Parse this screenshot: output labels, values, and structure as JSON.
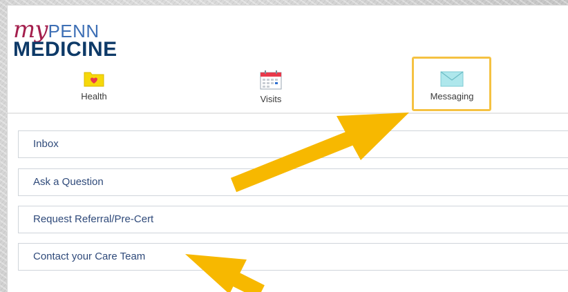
{
  "app": {
    "logo": {
      "my": "my",
      "penn": "PENN",
      "medicine": "MEDICINE"
    }
  },
  "nav": {
    "items": [
      {
        "label": "Health",
        "icon": "folder-heart-icon"
      },
      {
        "label": "Visits",
        "icon": "calendar-icon"
      },
      {
        "label": "Messaging",
        "icon": "envelope-icon",
        "highlighted": true
      }
    ]
  },
  "menu": {
    "items": [
      {
        "label": "Inbox"
      },
      {
        "label": "Ask a Question"
      },
      {
        "label": "Request Referral/Pre-Cert"
      },
      {
        "label": "Contact your Care Team"
      }
    ]
  },
  "colors": {
    "logo_my": "#a41f4d",
    "logo_penn": "#3d6fb5",
    "logo_medicine": "#0e3a68",
    "highlight_border": "#f5c242",
    "arrow": "#f7b800",
    "menu_text": "#2f4a7a"
  }
}
